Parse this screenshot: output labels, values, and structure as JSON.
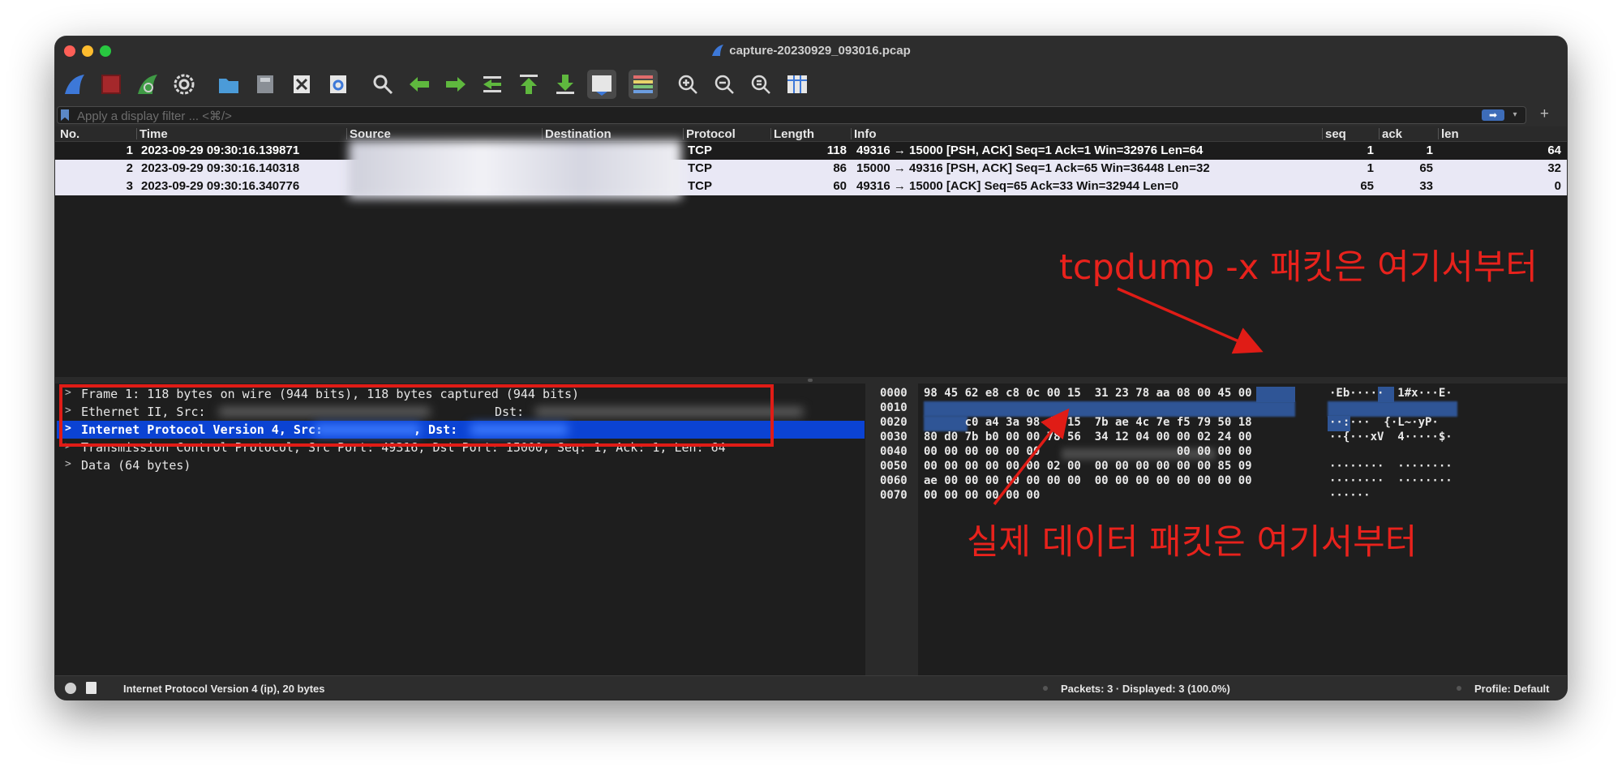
{
  "window": {
    "title": "capture-20230929_093016.pcap"
  },
  "toolbar": {
    "buttons": [
      "shark-start-icon",
      "stop-icon",
      "restart-icon",
      "options-gear-icon",
      "open-file-icon",
      "save-file-icon",
      "close-file-icon",
      "reload-icon",
      "find-icon",
      "go-back-icon",
      "go-forward-icon",
      "go-to-packet-icon",
      "first-packet-icon",
      "last-packet-icon",
      "autoscroll-icon",
      "colorize-icon",
      "zoom-in-icon",
      "zoom-out-icon",
      "zoom-normal-icon",
      "resize-columns-icon"
    ]
  },
  "filter": {
    "placeholder": "Apply a display filter ... <⌘/>"
  },
  "columns": [
    "No.",
    "Time",
    "Source",
    "Destination",
    "Protocol",
    "Length",
    "Info",
    "seq",
    "ack",
    "len"
  ],
  "packets": [
    {
      "no": "1",
      "time": "2023-09-29 09:30:16.139871",
      "protocol": "TCP",
      "length": "118",
      "info": "49316 → 15000 [PSH, ACK] Seq=1 Ack=1 Win=32976 Len=64",
      "seq": "1",
      "ack": "1",
      "len": "64"
    },
    {
      "no": "2",
      "time": "2023-09-29 09:30:16.140318",
      "protocol": "TCP",
      "length": "86",
      "info": "15000 → 49316 [PSH, ACK] Seq=1 Ack=65 Win=36448 Len=32",
      "seq": "1",
      "ack": "65",
      "len": "32"
    },
    {
      "no": "3",
      "time": "2023-09-29 09:30:16.340776",
      "protocol": "TCP",
      "length": "60",
      "info": "49316 → 15000 [ACK] Seq=65 Ack=33 Win=32944 Len=0",
      "seq": "65",
      "ack": "33",
      "len": "0"
    }
  ],
  "details": [
    "Frame 1: 118 bytes on wire (944 bits), 118 bytes captured (944 bits)",
    "Ethernet II, Src:",
    "Internet Protocol Version 4, Src:",
    "Transmission Control Protocol, Src Port: 49316, Dst Port: 15000, Seq: 1, Ack: 1, Len: 64",
    "Data (64 bytes)"
  ],
  "details_extra": {
    "dst_label": "Dst:",
    "ip_dst_label": ", Dst:"
  },
  "hex": {
    "offsets": [
      "0000",
      "0010",
      "0020",
      "0030",
      "0040",
      "0050",
      "0060",
      "0070"
    ],
    "lines": [
      "98 45 62 e8 c8 0c 00 15  31 23 78 aa 08 00 45 00",
      "",
      "      c0 a4 3a 98 d1 15  7b ae 4c 7e f5 79 50 18",
      "80 d0 7b b0 00 00 78 56  34 12 04 00 00 02 24 00",
      "00 00 00 00 00 00                    00 00 00 00",
      "00 00 00 00 00 00 02 00  00 00 00 00 00 00 85 09",
      "ae 00 00 00 00 00 00 00  00 00 00 00 00 00 00 00",
      "00 00 00 00 00 00"
    ],
    "ascii": [
      "·Eb·····  1#x···E·",
      "",
      "··:···  {·L~·yP·",
      "··{···xV  4·····$·",
      "",
      "········  ········",
      "········  ········",
      "······"
    ]
  },
  "status": {
    "left": "Internet Protocol Version 4 (ip), 20 bytes",
    "middle": "Packets: 3 · Displayed: 3 (100.0%)",
    "right": "Profile: Default"
  },
  "annotations": {
    "top": "tcpdump -x 패킷은 여기서부터",
    "bottom": "실제 데이터 패킷은 여기서부터"
  },
  "colors": {
    "accent": "#0b43d3",
    "annotation": "#e8221c",
    "related_row": "#e9e8f5"
  }
}
